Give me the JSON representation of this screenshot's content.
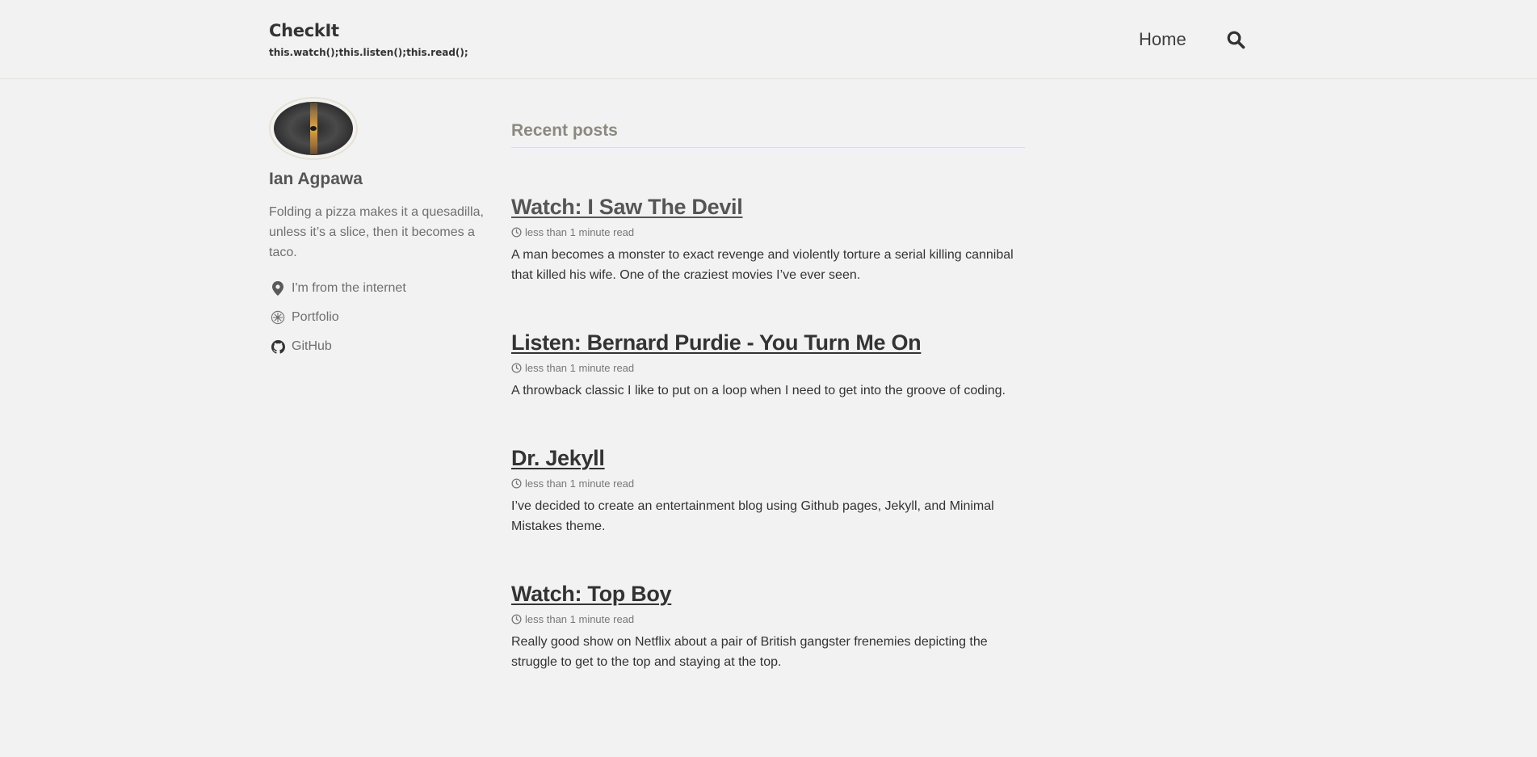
{
  "masthead": {
    "site_title": "CheckIt",
    "site_subtitle": "this.watch();this.listen();this.read();",
    "nav": [
      {
        "label": "Home"
      }
    ],
    "search_icon": "search-icon"
  },
  "sidebar": {
    "author_name": "Ian Agpawa",
    "author_bio": "Folding a pizza makes it a quesadilla, unless it’s a slice, then it becomes a taco.",
    "links": [
      {
        "label": "I'm from the internet",
        "icon": "map-marker-icon"
      },
      {
        "label": "Portfolio",
        "icon": "portfolio-icon"
      },
      {
        "label": "GitHub",
        "icon": "github-icon"
      }
    ]
  },
  "main": {
    "section_title": "Recent posts",
    "posts": [
      {
        "title": "Watch: I Saw The Devil",
        "read_time": "less than 1 minute read",
        "excerpt": "A man becomes a monster to exact revenge and violently torture a serial killing cannibal that killed his wife. One of the craziest movies I’ve ever seen."
      },
      {
        "title": "Listen: Bernard Purdie - You Turn Me On",
        "read_time": "less than 1 minute read",
        "excerpt": "A throwback classic I like to put on a loop when I need to get into the groove of coding."
      },
      {
        "title": "Dr. Jekyll",
        "read_time": "less than 1 minute read",
        "excerpt": "I’ve decided to create an entertainment blog using Github pages, Jekyll, and Minimal Mistakes theme."
      },
      {
        "title": "Watch: Top Boy",
        "read_time": "less than 1 minute read",
        "excerpt": "Really good show on Netflix about a pair of British gangster frenemies depicting the struggle to get to the top and staying at the top."
      }
    ]
  },
  "colors": {
    "background": "#f2f2f2",
    "text": "#333333",
    "muted": "#6f6f6f",
    "rule": "#e0ddc9"
  }
}
